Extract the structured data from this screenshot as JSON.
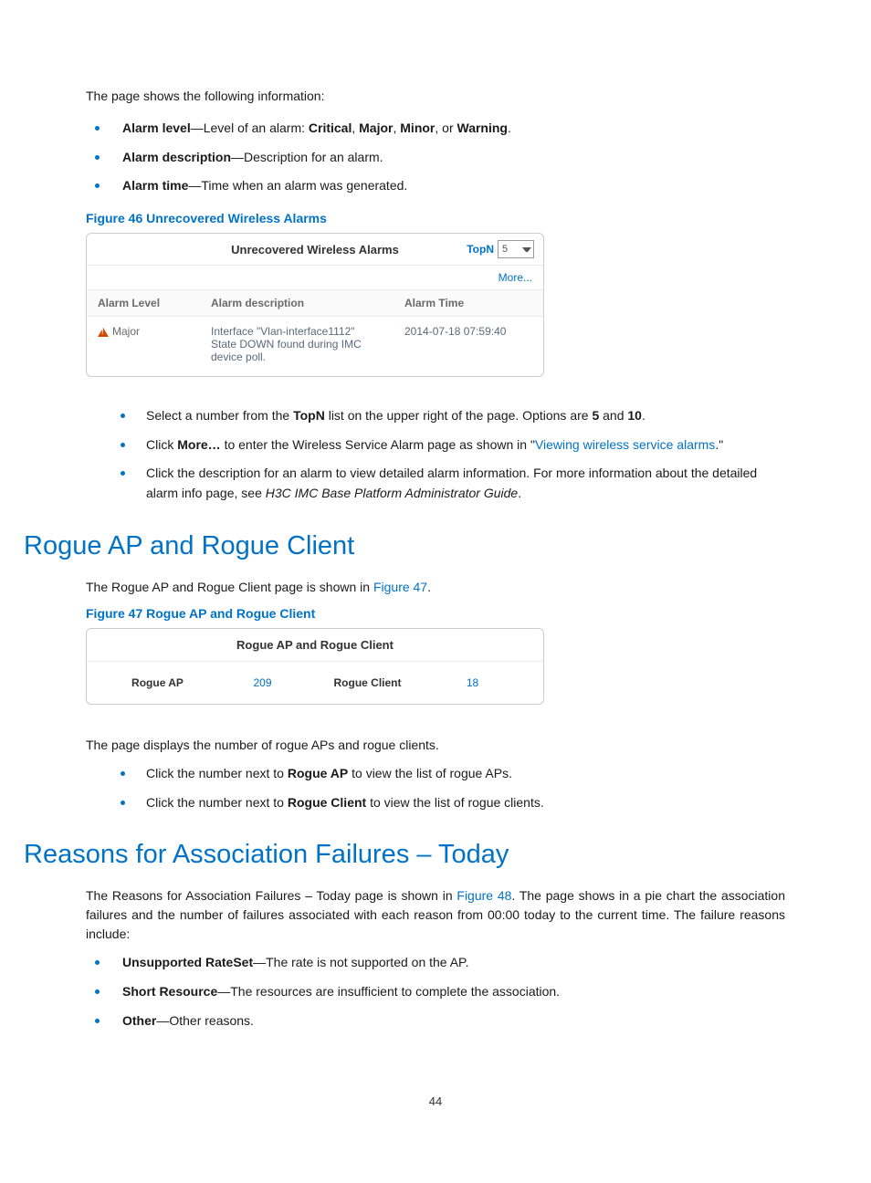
{
  "intro": "The page shows the following information:",
  "bullets1": [
    {
      "b": "Alarm level",
      "t1": "—Level of an alarm: ",
      "inline": [
        {
          "b": "Critical"
        },
        {
          "t": ", "
        },
        {
          "b": "Major"
        },
        {
          "t": ", "
        },
        {
          "b": "Minor"
        },
        {
          "t": ", or "
        },
        {
          "b": "Warning"
        },
        {
          "t": "."
        }
      ]
    },
    {
      "b": "Alarm description",
      "t1": "—Description for an alarm."
    },
    {
      "b": "Alarm time",
      "t1": "—Time when an alarm was generated."
    }
  ],
  "fig46": {
    "caption": "Figure 46 Unrecovered Wireless Alarms",
    "title": "Unrecovered Wireless Alarms",
    "topn_label": "TopN",
    "topn_value": "5",
    "more": "More...",
    "col_level": "Alarm Level",
    "col_desc": "Alarm description",
    "col_time": "Alarm Time",
    "row_level": "Major",
    "row_desc": "Interface \"Vlan-interface1112\" State DOWN found during IMC device poll.",
    "row_time": "2014-07-18 07:59:40"
  },
  "bullets2": {
    "i0_a": "Select a number from the ",
    "i0_b": "TopN",
    "i0_c": " list on the upper right of the page. Options are ",
    "i0_d": "5",
    "i0_e": " and ",
    "i0_f": "10",
    "i0_g": ".",
    "i1_a": "Click ",
    "i1_b": "More…",
    "i1_c": " to enter the Wireless Service Alarm page as shown in \"",
    "i1_link": "Viewing wireless service alarms",
    "i1_d": ".\"",
    "i2_a": "Click the description for an alarm to view detailed alarm information. For more information about the detailed alarm info page, see ",
    "i2_guide": "H3C IMC Base Platform Administrator Guide",
    "i2_b": "."
  },
  "h_rogue": "Rogue AP and Rogue Client",
  "rogue_intro_a": "The Rogue AP and Rogue Client page is shown in ",
  "rogue_intro_link": "Figure 47",
  "rogue_intro_b": ".",
  "fig47": {
    "caption": "Figure 47 Rogue AP and Rogue Client",
    "title": "Rogue AP and Rogue Client",
    "k1": "Rogue AP",
    "v1": "209",
    "k2": "Rogue Client",
    "v2": "18"
  },
  "rogue_p": "The page displays the number of rogue APs and rogue clients.",
  "rogue_b1_a": "Click the number next to ",
  "rogue_b1_b": "Rogue AP",
  "rogue_b1_c": " to view the list of rogue APs.",
  "rogue_b2_a": "Click the number next to ",
  "rogue_b2_b": "Rogue Client",
  "rogue_b2_c": " to view the list of rogue clients.",
  "h_reasons": "Reasons for Association Failures – Today",
  "reasons_p_a": "The Reasons for Association Failures – Today page is shown in ",
  "reasons_p_link": "Figure 48",
  "reasons_p_b": ". The page shows in a pie chart the association failures and the number of failures associated with each reason from 00:00 today to the current time. The failure reasons include:",
  "reasons_bullets": {
    "b1a": "Unsupported RateSet",
    "b1b": "—The rate is not supported on the AP.",
    "b2a": "Short Resource",
    "b2b": "—The resources are insufficient to complete the association.",
    "b3a": "Other",
    "b3b": "—Other reasons."
  },
  "page_number": "44"
}
